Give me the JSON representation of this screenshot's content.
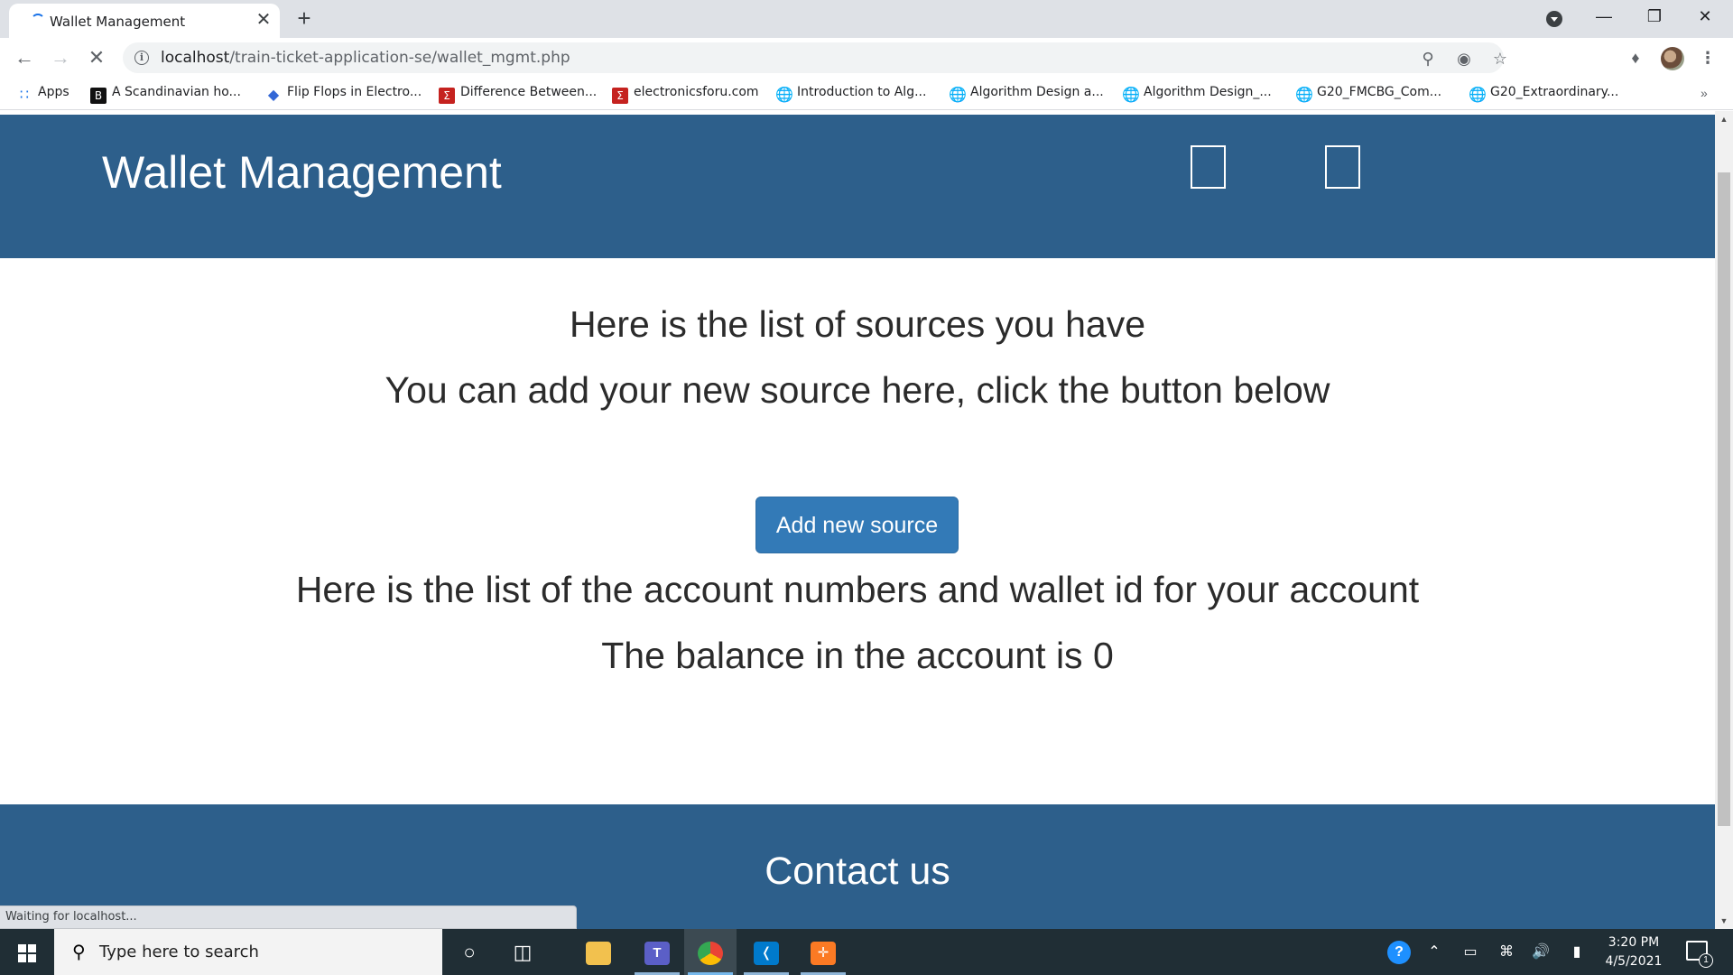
{
  "browser": {
    "tab_title": "Wallet Management",
    "tab_close": "✕",
    "new_tab": "+",
    "url_host": "localhost",
    "url_path": "/train-ticket-application-se/wallet_mgmt.php",
    "bookmarks": [
      {
        "label": "Apps",
        "icon": "apps-grid-icon"
      },
      {
        "label": "A Scandinavian ho...",
        "icon": "b-logo-icon"
      },
      {
        "label": "Flip Flops in Electro...",
        "icon": "diamond-icon"
      },
      {
        "label": "Difference Between...",
        "icon": "sigma-icon"
      },
      {
        "label": "electronicsforu.com",
        "icon": "sigma-icon"
      },
      {
        "label": "Introduction to Alg...",
        "icon": "globe-icon"
      },
      {
        "label": "Algorithm Design a...",
        "icon": "globe-icon"
      },
      {
        "label": "Algorithm Design_...",
        "icon": "globe-icon"
      },
      {
        "label": "G20_FMCBG_Com...",
        "icon": "globe-icon"
      },
      {
        "label": "G20_Extraordinary...",
        "icon": "globe-icon"
      }
    ],
    "bookmarks_more": "»",
    "status_text": "Waiting for localhost..."
  },
  "page": {
    "site_title": "Wallet Management",
    "sources_heading": "Here is the list of sources you have",
    "add_prompt": "You can add your new source here, click the button below",
    "add_button_label": "Add new source",
    "accounts_heading": "Here is the list of the account numbers and wallet id for your account",
    "balance_text": "The balance in the account is 0",
    "footer_title": "Contact us"
  },
  "taskbar": {
    "search_placeholder": "Type here to search",
    "time": "3:20 PM",
    "date": "4/5/2021",
    "notification_count": "1"
  },
  "colors": {
    "header_bg": "#2d5f8b",
    "button_bg": "#337ab7",
    "taskbar_bg": "#202e35"
  }
}
